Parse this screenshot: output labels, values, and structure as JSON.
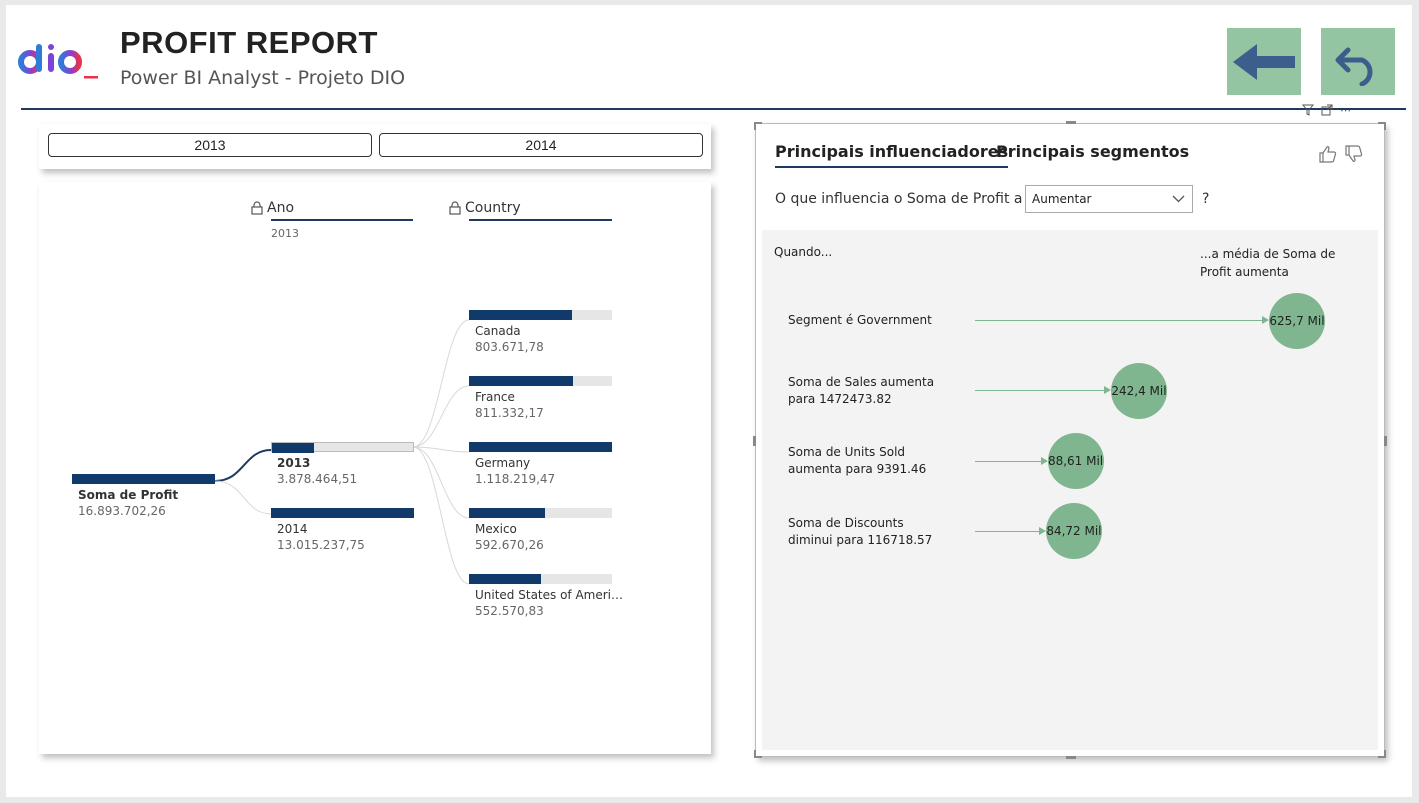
{
  "header": {
    "title": "PROFIT REPORT",
    "subtitle": "Power BI Analyst - Projeto DIO",
    "logo_text": "dio._",
    "back_icon": "arrow-left-icon",
    "undo_icon": "undo-icon"
  },
  "colors": {
    "accent": "#1f3a5f",
    "bar": "#0f3a6b",
    "nav_button": "#93c5a2",
    "bubble": "#7fb58f"
  },
  "slicer": {
    "options": [
      "2013",
      "2014"
    ]
  },
  "decomposition": {
    "columns": [
      {
        "title": "Ano",
        "filter": "2013",
        "icon": "lock-icon"
      },
      {
        "title": "Country",
        "filter": "",
        "icon": "lock-icon"
      }
    ],
    "root": {
      "label": "Soma de Profit",
      "value": "16.893.702,26"
    },
    "years": [
      {
        "label": "2013",
        "value": "3.878.464,51",
        "fill": 0.3,
        "selected": true
      },
      {
        "label": "2014",
        "value": "13.015.237,75",
        "fill": 1.0,
        "selected": false
      }
    ],
    "countries": [
      {
        "label": "Canada",
        "value": "803.671,78",
        "fill": 0.72
      },
      {
        "label": "France",
        "value": "811.332,17",
        "fill": 0.73
      },
      {
        "label": "Germany",
        "value": "1.118.219,47",
        "fill": 1.0
      },
      {
        "label": "Mexico",
        "value": "592.670,26",
        "fill": 0.53
      },
      {
        "label": "United States of Ameri…",
        "value": "552.570,83",
        "fill": 0.5
      }
    ]
  },
  "key_influencers": {
    "tabs": [
      "Principais influenciadores",
      "Principais segmentos"
    ],
    "question": "O que influencia o Soma de Profit a",
    "dropdown_value": "Aumentar",
    "question_mark": "?",
    "when_label": "Quando...",
    "avg_label": "...a média de Soma de Profit aumenta",
    "feedback_icons": [
      "thumbs-up-icon",
      "thumbs-down-icon"
    ],
    "influencers": [
      {
        "label": "Segment é Government",
        "value": "625,7 Mil",
        "amount": 625.7
      },
      {
        "label": "Soma de Sales aumenta para 1472473.82",
        "value": "242,4 Mil",
        "amount": 242.4
      },
      {
        "label": "Soma de Units Sold aumenta para 9391.46",
        "value": "88,61 Mil",
        "amount": 88.61
      },
      {
        "label": "Soma de Discounts diminui para 116718.57",
        "value": "84,72 Mil",
        "amount": 84.72
      }
    ]
  }
}
